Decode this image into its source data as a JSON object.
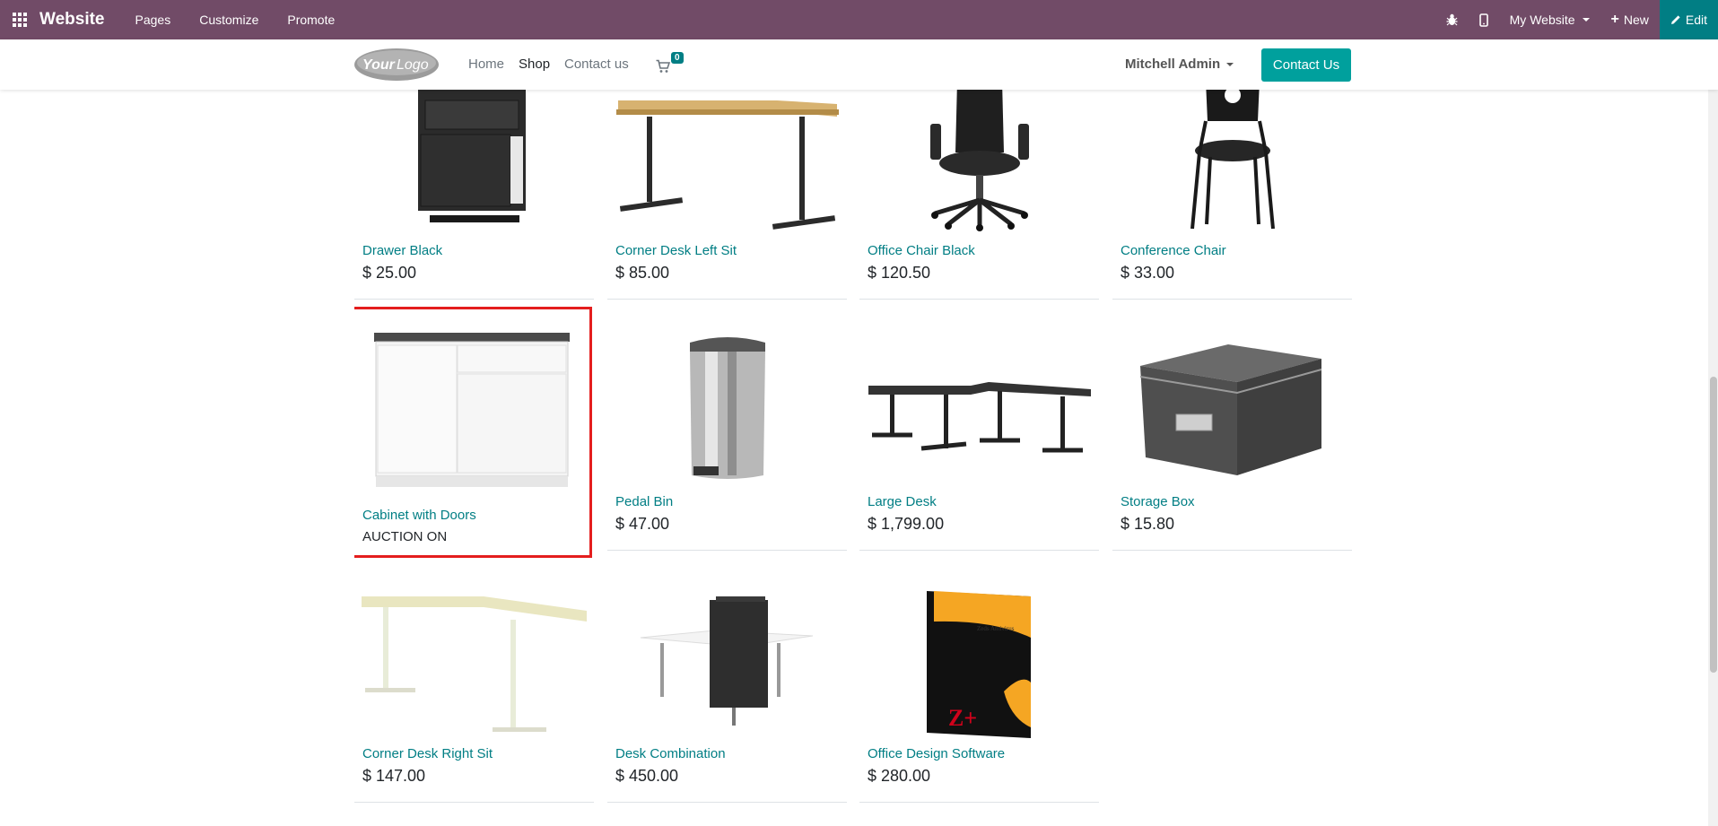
{
  "admin_bar": {
    "brand": "Website",
    "menu": [
      {
        "label": "Pages"
      },
      {
        "label": "Customize"
      },
      {
        "label": "Promote"
      }
    ],
    "website_selector": "My Website",
    "new_label": "New",
    "edit_label": "Edit",
    "color": "#714B67"
  },
  "header": {
    "logo_text": "YourLogo",
    "nav": [
      {
        "label": "Home",
        "active": false
      },
      {
        "label": "Shop",
        "active": true
      },
      {
        "label": "Contact us",
        "active": false
      }
    ],
    "cart_count": "0",
    "user": "Mitchell Admin",
    "contact_button": "Contact Us"
  },
  "products": [
    {
      "name": "Drawer Black",
      "price": "$ 25.00",
      "icon": "drawer-cabinet"
    },
    {
      "name": "Corner Desk Left Sit",
      "price": "$ 85.00",
      "icon": "corner-desk"
    },
    {
      "name": "Office Chair Black",
      "price": "$ 120.50",
      "icon": "office-chair"
    },
    {
      "name": "Conference Chair",
      "price": "$ 33.00",
      "icon": "conference-chair"
    },
    {
      "name": "Cabinet with Doors",
      "price": "AUCTION ON",
      "icon": "cabinet",
      "highlighted": true
    },
    {
      "name": "Pedal Bin",
      "price": "$ 47.00",
      "icon": "pedal-bin"
    },
    {
      "name": "Large Desk",
      "price": "$ 1,799.00",
      "icon": "large-desk"
    },
    {
      "name": "Storage Box",
      "price": "$ 15.80",
      "icon": "storage-box"
    },
    {
      "name": "Corner Desk Right Sit",
      "price": "$ 147.00",
      "icon": "corner-desk-white"
    },
    {
      "name": "Desk Combination",
      "price": "$ 450.00",
      "icon": "desk-combination"
    },
    {
      "name": "Office Design Software",
      "price": "$ 280.00",
      "icon": "software-box"
    }
  ],
  "colors": {
    "accent": "#017E84",
    "contact_button": "#00A09D",
    "highlight_border": "#e41e1e"
  }
}
